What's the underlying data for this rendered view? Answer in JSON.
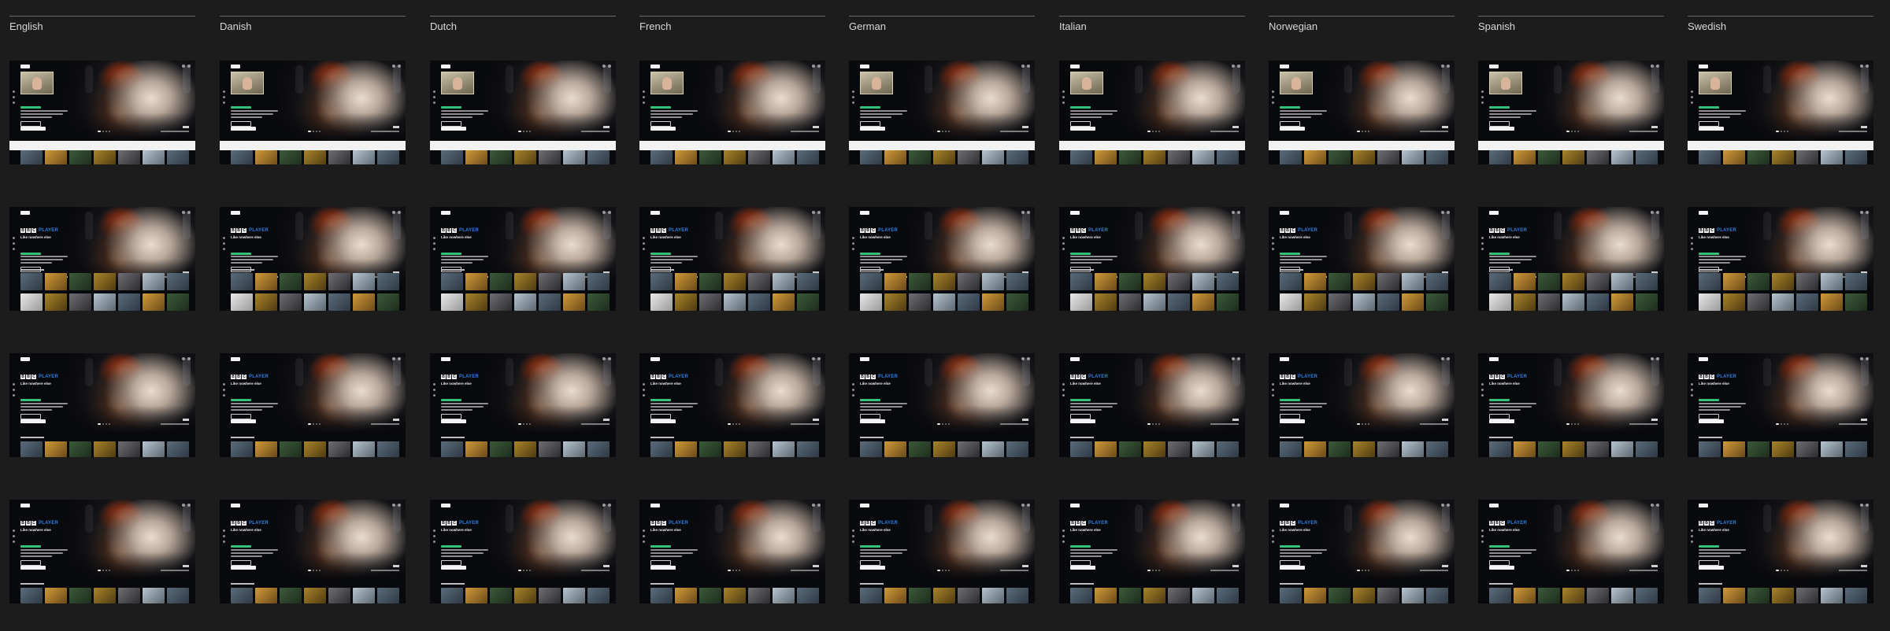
{
  "languages": [
    "English",
    "Danish",
    "Dutch",
    "French",
    "German",
    "Italian",
    "Norwegian",
    "Spanish",
    "Swedish"
  ],
  "tile_images": [
    "tile-1",
    "tile-2",
    "tile-3",
    "tile-4",
    "tile-5"
  ],
  "tile_texts": {
    "tile-3": "",
    "tile-5": ""
  },
  "hero": {
    "logo_letters": [
      "B",
      "B",
      "C"
    ],
    "logo_word": "PLAYER",
    "tagline": "Like nowhere else"
  },
  "colors": {
    "background": "#1c1c1c",
    "frame": "#08090d",
    "accent_blue": "#2f7fe0",
    "accent_green": "#36c07a"
  },
  "row_variants": [
    "preview-thumbnail",
    "logo-with-two-rows",
    "logo-with-cta",
    "logo-compact"
  ]
}
